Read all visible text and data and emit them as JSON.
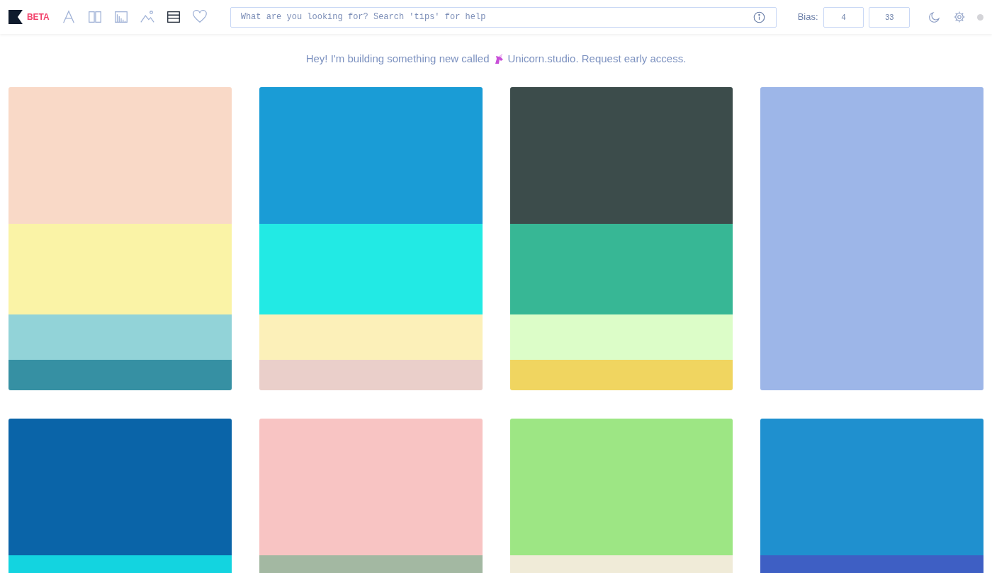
{
  "header": {
    "badge": "BETA",
    "nav": [
      {
        "kind": "type",
        "selected": false
      },
      {
        "kind": "columns",
        "selected": false
      },
      {
        "kind": "chart",
        "selected": false
      },
      {
        "kind": "image",
        "selected": false
      },
      {
        "kind": "list",
        "selected": true
      },
      {
        "kind": "heart",
        "selected": false
      }
    ],
    "search": {
      "placeholder": "What are you looking for? Search 'tips' for help"
    },
    "bias": {
      "label": "Bias:",
      "values": [
        "4",
        "33"
      ]
    }
  },
  "banner": {
    "before": "Hey! I'm building something new called",
    "after": "Unicorn.studio. Request early access."
  },
  "palettes": [
    {
      "segments": [
        {
          "color": "#f9d9c7"
        },
        {
          "color": "#faf3a6"
        },
        {
          "color": "#92d3d8"
        },
        {
          "color": "#3690a3"
        }
      ]
    },
    {
      "segments": [
        {
          "color": "#1a9cd6"
        },
        {
          "color": "#22eae4"
        },
        {
          "color": "#fcf0b9"
        },
        {
          "color": "#eacfca"
        }
      ]
    },
    {
      "segments": [
        {
          "color": "#3c4c4b"
        },
        {
          "color": "#37b795"
        },
        {
          "color": "#dcfdc8"
        },
        {
          "color": "#f0d560"
        }
      ]
    },
    {
      "segments": [
        {
          "color": "#9db6e8"
        }
      ]
    },
    {
      "segments": [
        {
          "color": "#0a64a8"
        },
        {
          "color": "#13d4e0"
        }
      ]
    },
    {
      "segments": [
        {
          "color": "#f8c4c3"
        },
        {
          "color": "#a3b8a2"
        }
      ]
    },
    {
      "segments": [
        {
          "color": "#9de684"
        },
        {
          "color": "#f0ebd8"
        }
      ]
    },
    {
      "segments": [
        {
          "color": "#1f90cf"
        },
        {
          "color": "#3e5fc4"
        }
      ]
    }
  ]
}
